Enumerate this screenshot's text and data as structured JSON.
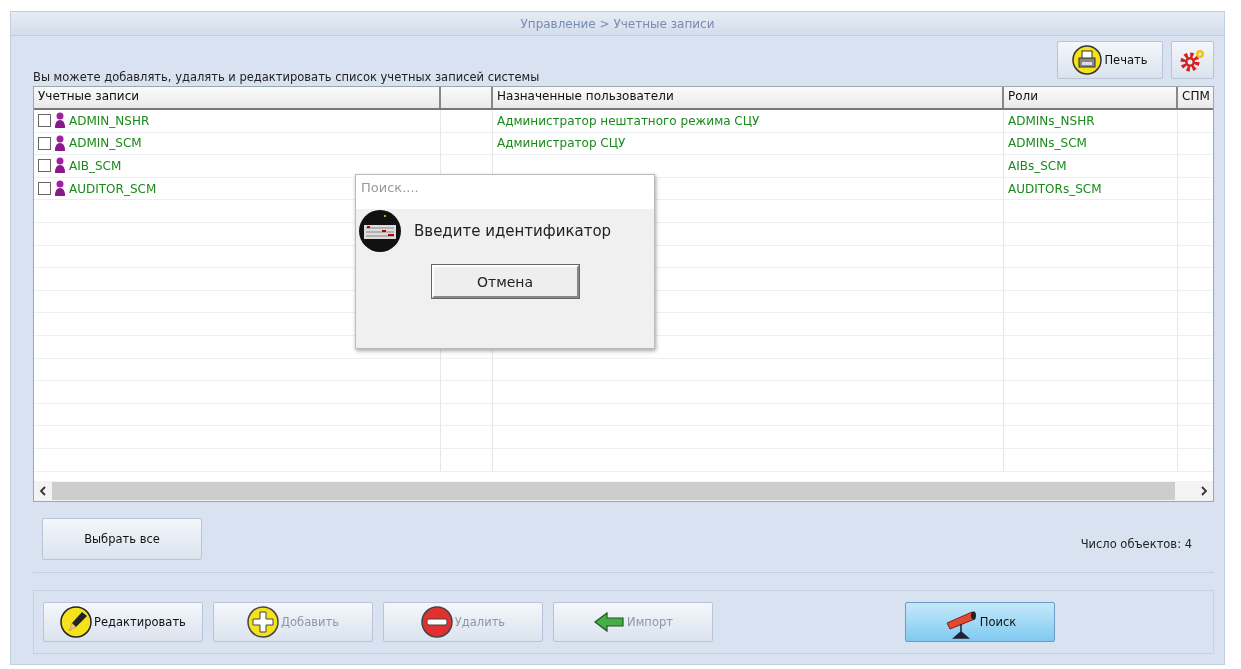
{
  "header": {
    "breadcrumb": "Управление > Учетные записи"
  },
  "description": "Вы можете добавлять, удалять и редактировать список учетных записей системы",
  "top_buttons": {
    "print": "Печать"
  },
  "table": {
    "columns": [
      "Учетные записи",
      "",
      "Назначенные пользователи",
      "Роли",
      "СПМ"
    ],
    "rows": [
      {
        "account": "ADMIN_NSHR",
        "checked": false,
        "users": "Администратор нештатного режима СЦУ",
        "roles": "ADMINs_NSHR"
      },
      {
        "account": "ADMIN_SCM",
        "checked": false,
        "users": "Администратор СЦУ",
        "roles": "ADMINs_SCM"
      },
      {
        "account": "AIB_SCM",
        "checked": false,
        "roles": "AIBs_SCM"
      },
      {
        "account": "AUDITOR_SCM",
        "checked": false,
        "roles": "AUDITORs_SCM"
      }
    ]
  },
  "select_all": "Выбрать все",
  "count": "Число объектов: 4",
  "actions": [
    {
      "label": "Редактировать",
      "disabled": false,
      "selected": false
    },
    {
      "label": "Добавить",
      "disabled": true,
      "selected": false
    },
    {
      "label": "Удалить",
      "disabled": true,
      "selected": false
    },
    {
      "label": "Импорт",
      "disabled": true,
      "selected": false
    }
  ],
  "search_button": {
    "label": "Поиск",
    "selected": true
  },
  "dialog": {
    "title": "Поиск....",
    "message": "Введите идентификатор",
    "cancel": "Отмена"
  }
}
